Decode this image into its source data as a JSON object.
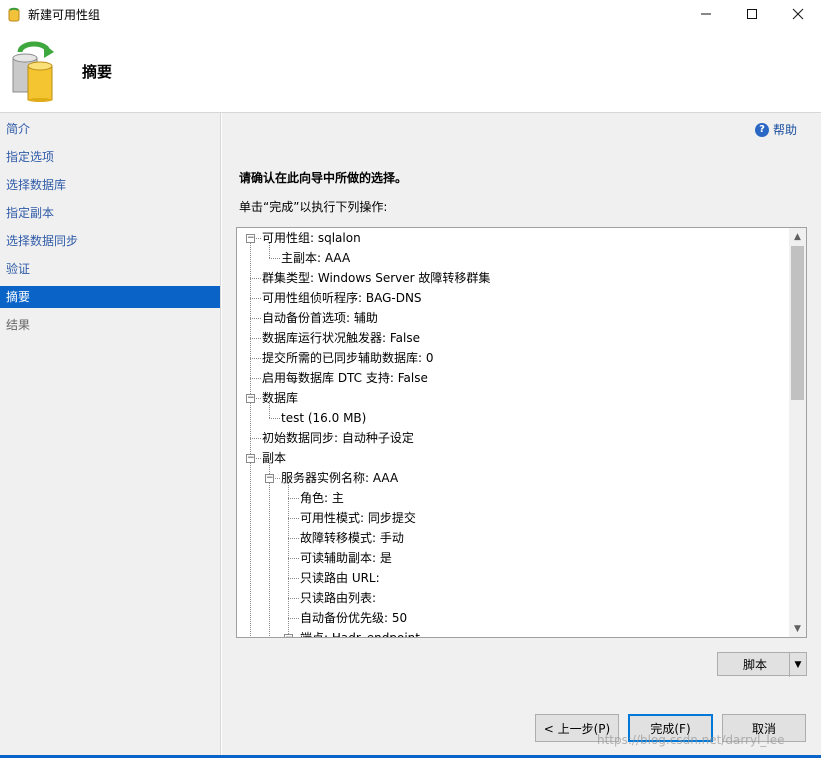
{
  "window": {
    "title": "新建可用性组",
    "minimize_icon": "minimize-icon",
    "maximize_icon": "maximize-icon",
    "close_icon": "close-icon"
  },
  "header": {
    "title": "摘要",
    "icon": "database-sync-icon"
  },
  "sidebar": {
    "items": [
      {
        "label": "简介",
        "state": "normal"
      },
      {
        "label": "指定选项",
        "state": "normal"
      },
      {
        "label": "选择数据库",
        "state": "normal"
      },
      {
        "label": "指定副本",
        "state": "normal"
      },
      {
        "label": "选择数据同步",
        "state": "normal"
      },
      {
        "label": "验证",
        "state": "normal"
      },
      {
        "label": "摘要",
        "state": "selected"
      },
      {
        "label": "结果",
        "state": "disabled"
      }
    ]
  },
  "main": {
    "help_label": "帮助",
    "confirm_text": "请确认在此向导中所做的选择。",
    "instruction_text": "单击“完成”以执行下列操作:",
    "tree": [
      {
        "text": "可用性组: sqlalon",
        "level": 0,
        "expander": "minus"
      },
      {
        "text": "主副本: AAA",
        "level": 1
      },
      {
        "text": "群集类型: Windows Server 故障转移群集",
        "level": 0
      },
      {
        "text": "可用性组侦听程序: BAG-DNS",
        "level": 0
      },
      {
        "text": "自动备份首选项: 辅助",
        "level": 0
      },
      {
        "text": "数据库运行状况触发器: False",
        "level": 0
      },
      {
        "text": "提交所需的已同步辅助数据库: 0",
        "level": 0
      },
      {
        "text": "启用每数据库 DTC 支持: False",
        "level": 0
      },
      {
        "text": "数据库",
        "level": 0,
        "expander": "minus"
      },
      {
        "text": "test (16.0 MB)",
        "level": 1
      },
      {
        "text": "初始数据同步: 自动种子设定",
        "level": 0
      },
      {
        "text": "副本",
        "level": 0,
        "expander": "minus"
      },
      {
        "text": "服务器实例名称: AAA",
        "level": 1,
        "expander": "minus"
      },
      {
        "text": "角色: 主",
        "level": 2
      },
      {
        "text": "可用性模式: 同步提交",
        "level": 2
      },
      {
        "text": "故障转移模式: 手动",
        "level": 2
      },
      {
        "text": "可读辅助副本: 是",
        "level": 2
      },
      {
        "text": "只读路由 URL:",
        "level": 2
      },
      {
        "text": "只读路由列表:",
        "level": 2
      },
      {
        "text": "自动备份优先级: 50",
        "level": 2
      },
      {
        "text": "端点: Hadr_endpoint",
        "level": 2,
        "expander": "minus"
      }
    ]
  },
  "buttons": {
    "script_label": "脚本",
    "back_label": "< 上一步(P)",
    "finish_label": "完成(F)",
    "cancel_label": "取消"
  },
  "watermark": "https://blog.csdn.net/darryl_lee"
}
